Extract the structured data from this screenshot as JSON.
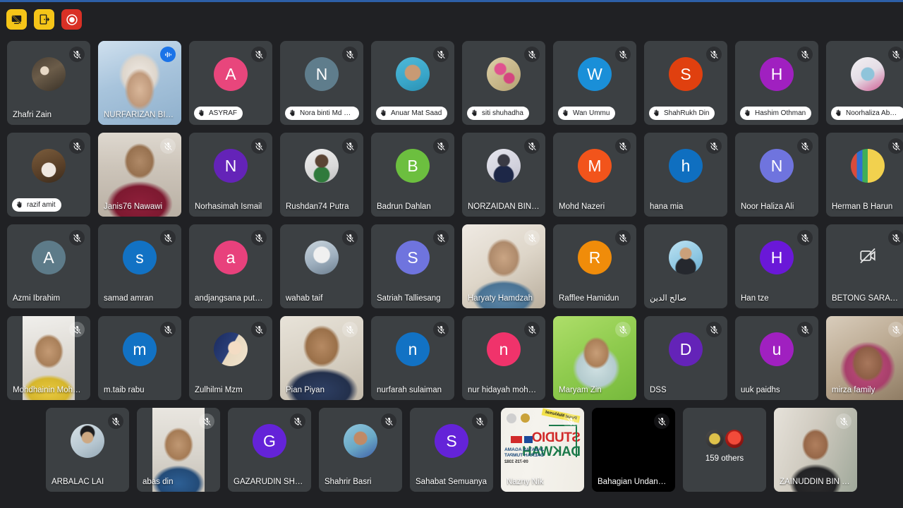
{
  "app": {
    "background_color": "#202124",
    "accent_color": "#2d5fa7",
    "tile_color": "#3c4043",
    "active_speaker_color": "#6aa5f4"
  },
  "toolbar": {
    "buttons": [
      {
        "name": "stop-presenting-button",
        "label": "Stop presenting",
        "icon": "screen-share-off-icon",
        "color": "#f5c518"
      },
      {
        "name": "leave-meeting-button",
        "label": "Leave meeting",
        "icon": "exit-door-icon",
        "color": "#f5c518"
      },
      {
        "name": "record-button",
        "label": "Record",
        "icon": "record-circle-icon",
        "color": "#d93025"
      }
    ]
  },
  "grid": {
    "rows": [
      [
        {
          "name": "Zhafri Zain",
          "style": "plain",
          "kind": "photo",
          "photo": "ph-zhafri",
          "muted": true
        },
        {
          "name": "NURFARIZAN BINTI ...",
          "style": "plain",
          "kind": "video",
          "video": "vid-nurfarizan",
          "muted": false,
          "active_speaker": true,
          "speaking": true
        },
        {
          "name": "ASYRAF",
          "style": "pill",
          "kind": "initial",
          "initial": "A",
          "color": "#e8467c",
          "muted": true
        },
        {
          "name": "Nora binti Md Naz...",
          "style": "pill",
          "kind": "initial",
          "initial": "N",
          "color": "#5f7d8c",
          "muted": true
        },
        {
          "name": "Anuar Mat Saad",
          "style": "pill",
          "kind": "photo",
          "photo": "ph-anuar",
          "muted": true
        },
        {
          "name": "siti shuhadha",
          "style": "pill",
          "kind": "photo",
          "photo": "ph-siti",
          "muted": true
        },
        {
          "name": "Wan Ummu",
          "style": "pill",
          "kind": "initial",
          "initial": "W",
          "color": "#1a8fd8",
          "muted": true
        },
        {
          "name": "ShahRukh Din",
          "style": "pill",
          "kind": "initial",
          "initial": "S",
          "color": "#e0400f",
          "muted": true
        },
        {
          "name": "Hashim Othman",
          "style": "pill",
          "kind": "initial",
          "initial": "H",
          "color": "#a020c0",
          "muted": true
        },
        {
          "name": "Noorhaliza Abu B...",
          "style": "pill",
          "kind": "photo",
          "photo": "ph-noorhaliza",
          "muted": true
        }
      ],
      [
        {
          "name": "razif amit",
          "style": "pill",
          "kind": "photo",
          "photo": "ph-razif",
          "muted": true
        },
        {
          "name": "Janis76 Nawawi",
          "style": "plain",
          "kind": "video",
          "video": "vid-janis",
          "muted": true
        },
        {
          "name": "Norhasimah Ismail",
          "style": "plain",
          "kind": "initial",
          "initial": "N",
          "color": "#6423b8",
          "muted": true
        },
        {
          "name": "Rushdan74 Putra",
          "style": "plain",
          "kind": "photo",
          "photo": "ph-rushdan",
          "muted": true
        },
        {
          "name": "Badrun Dahlan",
          "style": "plain",
          "kind": "initial",
          "initial": "B",
          "color": "#6cbf3f",
          "muted": true
        },
        {
          "name": "NORZAIDAN BIN HA...",
          "style": "plain",
          "kind": "photo",
          "photo": "ph-norzaidan",
          "muted": true
        },
        {
          "name": "Mohd Nazeri",
          "style": "plain",
          "kind": "initial",
          "initial": "M",
          "color": "#f2541b",
          "muted": true
        },
        {
          "name": "hana mia",
          "style": "plain",
          "kind": "initial",
          "initial": "h",
          "color": "#0f6fc0",
          "muted": true
        },
        {
          "name": "Noor Haliza Ali",
          "style": "plain",
          "kind": "initial",
          "initial": "N",
          "color": "#6f74de",
          "muted": true
        },
        {
          "name": "Herman B Harun",
          "style": "plain",
          "kind": "photo",
          "photo": "ph-herman",
          "muted": true
        }
      ],
      [
        {
          "name": "Azmi Ibrahim",
          "style": "plain",
          "kind": "initial",
          "initial": "A",
          "color": "#5d7b89",
          "muted": true
        },
        {
          "name": "samad amran",
          "style": "plain",
          "kind": "initial",
          "initial": "s",
          "color": "#1272c4",
          "muted": true
        },
        {
          "name": "andjangsana putera ...",
          "style": "plain",
          "kind": "initial",
          "initial": "a",
          "color": "#e8417c",
          "muted": true
        },
        {
          "name": "wahab taif",
          "style": "plain",
          "kind": "photo",
          "photo": "ph-wahab",
          "muted": true
        },
        {
          "name": "Satriah Talliesang",
          "style": "plain",
          "kind": "initial",
          "initial": "S",
          "color": "#6f74de",
          "muted": true
        },
        {
          "name": "Haryaty Hamdzah",
          "style": "plain",
          "kind": "video",
          "video": "vid-haryaty",
          "muted": true
        },
        {
          "name": "Rafflee Hamidun",
          "style": "plain",
          "kind": "initial",
          "initial": "R",
          "color": "#f08c0a",
          "muted": true
        },
        {
          "name": "صالح الدين",
          "style": "plain",
          "kind": "photo",
          "photo": "ph-salehudin",
          "muted": false
        },
        {
          "name": "Han tze",
          "style": "plain",
          "kind": "initial",
          "initial": "H",
          "color": "#6a18d8",
          "muted": true
        },
        {
          "name": "BETONG SARAWAK",
          "style": "plain",
          "kind": "camera-off",
          "muted": true
        }
      ],
      [
        {
          "name": "Mohdhainin Mohdh...",
          "style": "plain",
          "kind": "video-portrait",
          "video": "vid-mohdhainin",
          "muted": true
        },
        {
          "name": "m.taib rabu",
          "style": "plain",
          "kind": "initial",
          "initial": "m",
          "color": "#1272c4",
          "muted": true
        },
        {
          "name": "Zulhilmi Mzm",
          "style": "plain",
          "kind": "photo",
          "photo": "ph-zulhilmi",
          "muted": true
        },
        {
          "name": "Pian Piyan",
          "style": "plain",
          "kind": "video",
          "video": "vid-pian",
          "muted": true
        },
        {
          "name": "nurfarah sulaiman",
          "style": "plain",
          "kind": "initial",
          "initial": "n",
          "color": "#1272c4",
          "muted": true
        },
        {
          "name": "nur hidayah mohd isa",
          "style": "plain",
          "kind": "initial",
          "initial": "n",
          "color": "#f0336b",
          "muted": true
        },
        {
          "name": "Maryam Zin",
          "style": "plain",
          "kind": "video",
          "video": "vid-maryam",
          "muted": true
        },
        {
          "name": "DSS",
          "style": "plain",
          "kind": "initial",
          "initial": "D",
          "color": "#6423b8",
          "muted": true
        },
        {
          "name": "uuk paidhs",
          "style": "plain",
          "kind": "initial",
          "initial": "u",
          "color": "#a020c0",
          "muted": true
        },
        {
          "name": "mirza family",
          "style": "plain",
          "kind": "video",
          "video": "vid-mirza",
          "muted": true
        }
      ],
      [
        {
          "name": "ARBALAC LAI",
          "style": "plain",
          "kind": "photo",
          "photo": "ph-arbalac",
          "muted": true
        },
        {
          "name": "abas din",
          "style": "plain",
          "kind": "video-portrait",
          "video": "vid-abasdin",
          "muted": true
        },
        {
          "name": "GAZARUDIN SHAH",
          "style": "plain",
          "kind": "initial",
          "initial": "G",
          "color": "#6423d8",
          "muted": true
        },
        {
          "name": "Shahrir Basri",
          "style": "plain",
          "kind": "photo",
          "photo": "ph-shahrir",
          "muted": true
        },
        {
          "name": "Sahabat Semuanya",
          "style": "plain",
          "kind": "initial",
          "initial": "S",
          "color": "#6423d8",
          "muted": true
        },
        {
          "name": "Nazny Nik",
          "style": "plain",
          "kind": "video",
          "video": "vid-nazny",
          "muted": true,
          "banner": {
            "line1": "STUDIO",
            "line2": "DAKWAH",
            "line3": "JABATAN AGAMA",
            "line4": "DAERAH TUMPAT",
            "phone": "09-725 3382",
            "tag": "Pusat Maklumat"
          }
        },
        {
          "name": "Bahagian Undang-U...",
          "style": "plain",
          "kind": "black",
          "muted": true
        },
        {
          "name": "159 others",
          "style": "others",
          "kind": "others",
          "count_label": "159 others",
          "muted": false
        },
        {
          "name": "ZAINUDDIN BIN OT...",
          "style": "plain",
          "kind": "video",
          "video": "vid-zainuddin",
          "muted": true
        }
      ]
    ]
  }
}
